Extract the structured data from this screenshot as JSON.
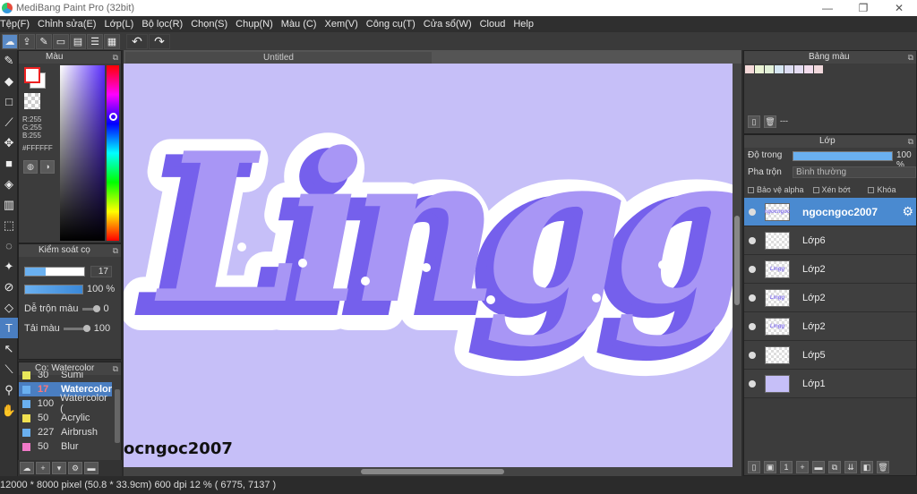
{
  "window": {
    "title": "MediBang Paint Pro (32bit)",
    "controls": [
      "—",
      "❐",
      "✕"
    ]
  },
  "menu": [
    "Tệp(F)",
    "Chỉnh sửa(E)",
    "Lớp(L)",
    "Bộ lọc(R)",
    "Chọn(S)",
    "Chụp(N)",
    "Màu (C)",
    "Xem(V)",
    "Công cụ(T)",
    "Cửa sổ(W)",
    "Cloud",
    "Help"
  ],
  "color_panel": {
    "title": "Màu",
    "r": "R:255",
    "g": "G:255",
    "b": "B:255",
    "hex": "#FFFFFF"
  },
  "brush_control": {
    "title": "Kiểm soát cọ",
    "size": "17",
    "opacity": "100 %",
    "blend_label": "Dễ trộn màu",
    "blend_value": "0",
    "load_label": "Tải màu",
    "load_value": "100"
  },
  "brush_panel": {
    "title": "Cọ: Watercolor",
    "items": [
      {
        "num": "30",
        "name": "Sumi",
        "color": "#e8e85a"
      },
      {
        "num": "17",
        "name": "Watercolor",
        "color": "#6ab0f0",
        "selected": true
      },
      {
        "num": "100",
        "name": "Watercolor (",
        "color": "#6ab0f0"
      },
      {
        "num": "50",
        "name": "Acrylic",
        "color": "#f0e050"
      },
      {
        "num": "227",
        "name": "Airbrush",
        "color": "#6ab0f0"
      },
      {
        "num": "50",
        "name": "Blur",
        "color": "#f07ac8"
      }
    ]
  },
  "canvas": {
    "tab": "Untitled",
    "artwork_text": "Lingg",
    "watermark": "ocngoc2007"
  },
  "status": {
    "text": "12000 * 8000 pixel   (50.8 * 33.9cm)   600 dpi   12 %   ( 6775, 7137 )"
  },
  "palette_panel": {
    "title": "Bảng màu",
    "swatches": [
      "#f4d9d9",
      "#e9f2d4",
      "#e2f0d8",
      "#d6e6f2",
      "#dcdcf2",
      "#e4dcf2",
      "#f2dcec",
      "#f0d8dc"
    ],
    "dash": "---"
  },
  "layer_panel": {
    "title": "Lớp",
    "opacity_label": "Độ trong",
    "opacity_value": "100 %",
    "opacity_level": 1.0,
    "blend_label": "Pha trộn",
    "blend_value": "Bình thường",
    "protect_alpha": "Bảo vệ alpha",
    "clipping": "Xén bớt",
    "lock": "Khóa",
    "layers": [
      {
        "name": "ngocngoc2007",
        "thumb": "text",
        "selected": true
      },
      {
        "name": "Lớp6",
        "thumb": "empty"
      },
      {
        "name": "Lớp2",
        "thumb": "art"
      },
      {
        "name": "Lớp2",
        "thumb": "art"
      },
      {
        "name": "Lớp2",
        "thumb": "art"
      },
      {
        "name": "Lớp5",
        "thumb": "empty"
      },
      {
        "name": "Lớp1",
        "thumb": "fill"
      }
    ]
  }
}
